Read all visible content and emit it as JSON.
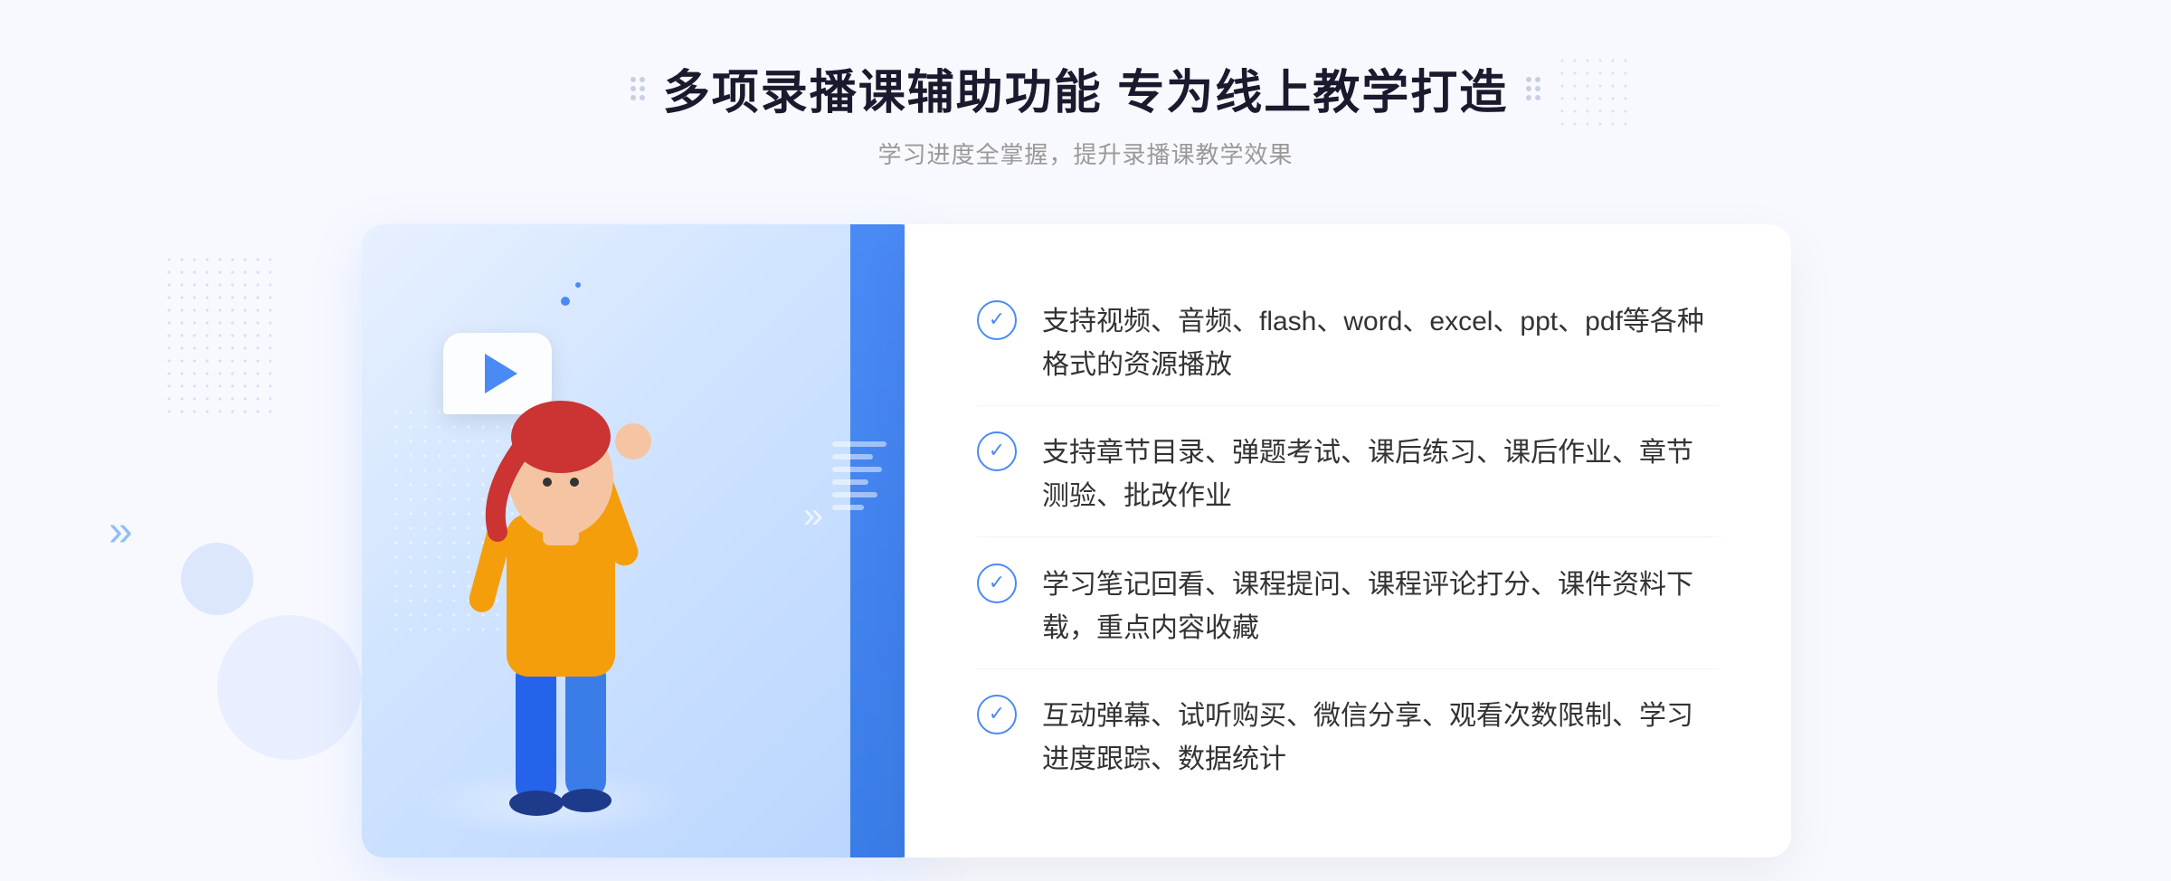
{
  "page": {
    "background": "#f8f9ff"
  },
  "header": {
    "title": "多项录播课辅助功能 专为线上教学打造",
    "subtitle": "学习进度全掌握，提升录播课教学效果",
    "left_dots_aria": "decorative-dots-left",
    "right_dots_aria": "decorative-dots-right"
  },
  "features": [
    {
      "id": 1,
      "text": "支持视频、音频、flash、word、excel、ppt、pdf等各种格式的资源播放"
    },
    {
      "id": 2,
      "text": "支持章节目录、弹题考试、课后练习、课后作业、章节测验、批改作业"
    },
    {
      "id": 3,
      "text": "学习笔记回看、课程提问、课程评论打分、课件资料下载，重点内容收藏"
    },
    {
      "id": 4,
      "text": "互动弹幕、试听购买、微信分享、观看次数限制、学习进度跟踪、数据统计"
    }
  ],
  "illustration": {
    "play_button_aria": "play-button",
    "person_aria": "person-figure"
  },
  "decorations": {
    "chevron_left": "»",
    "chevrons_right": "»"
  }
}
